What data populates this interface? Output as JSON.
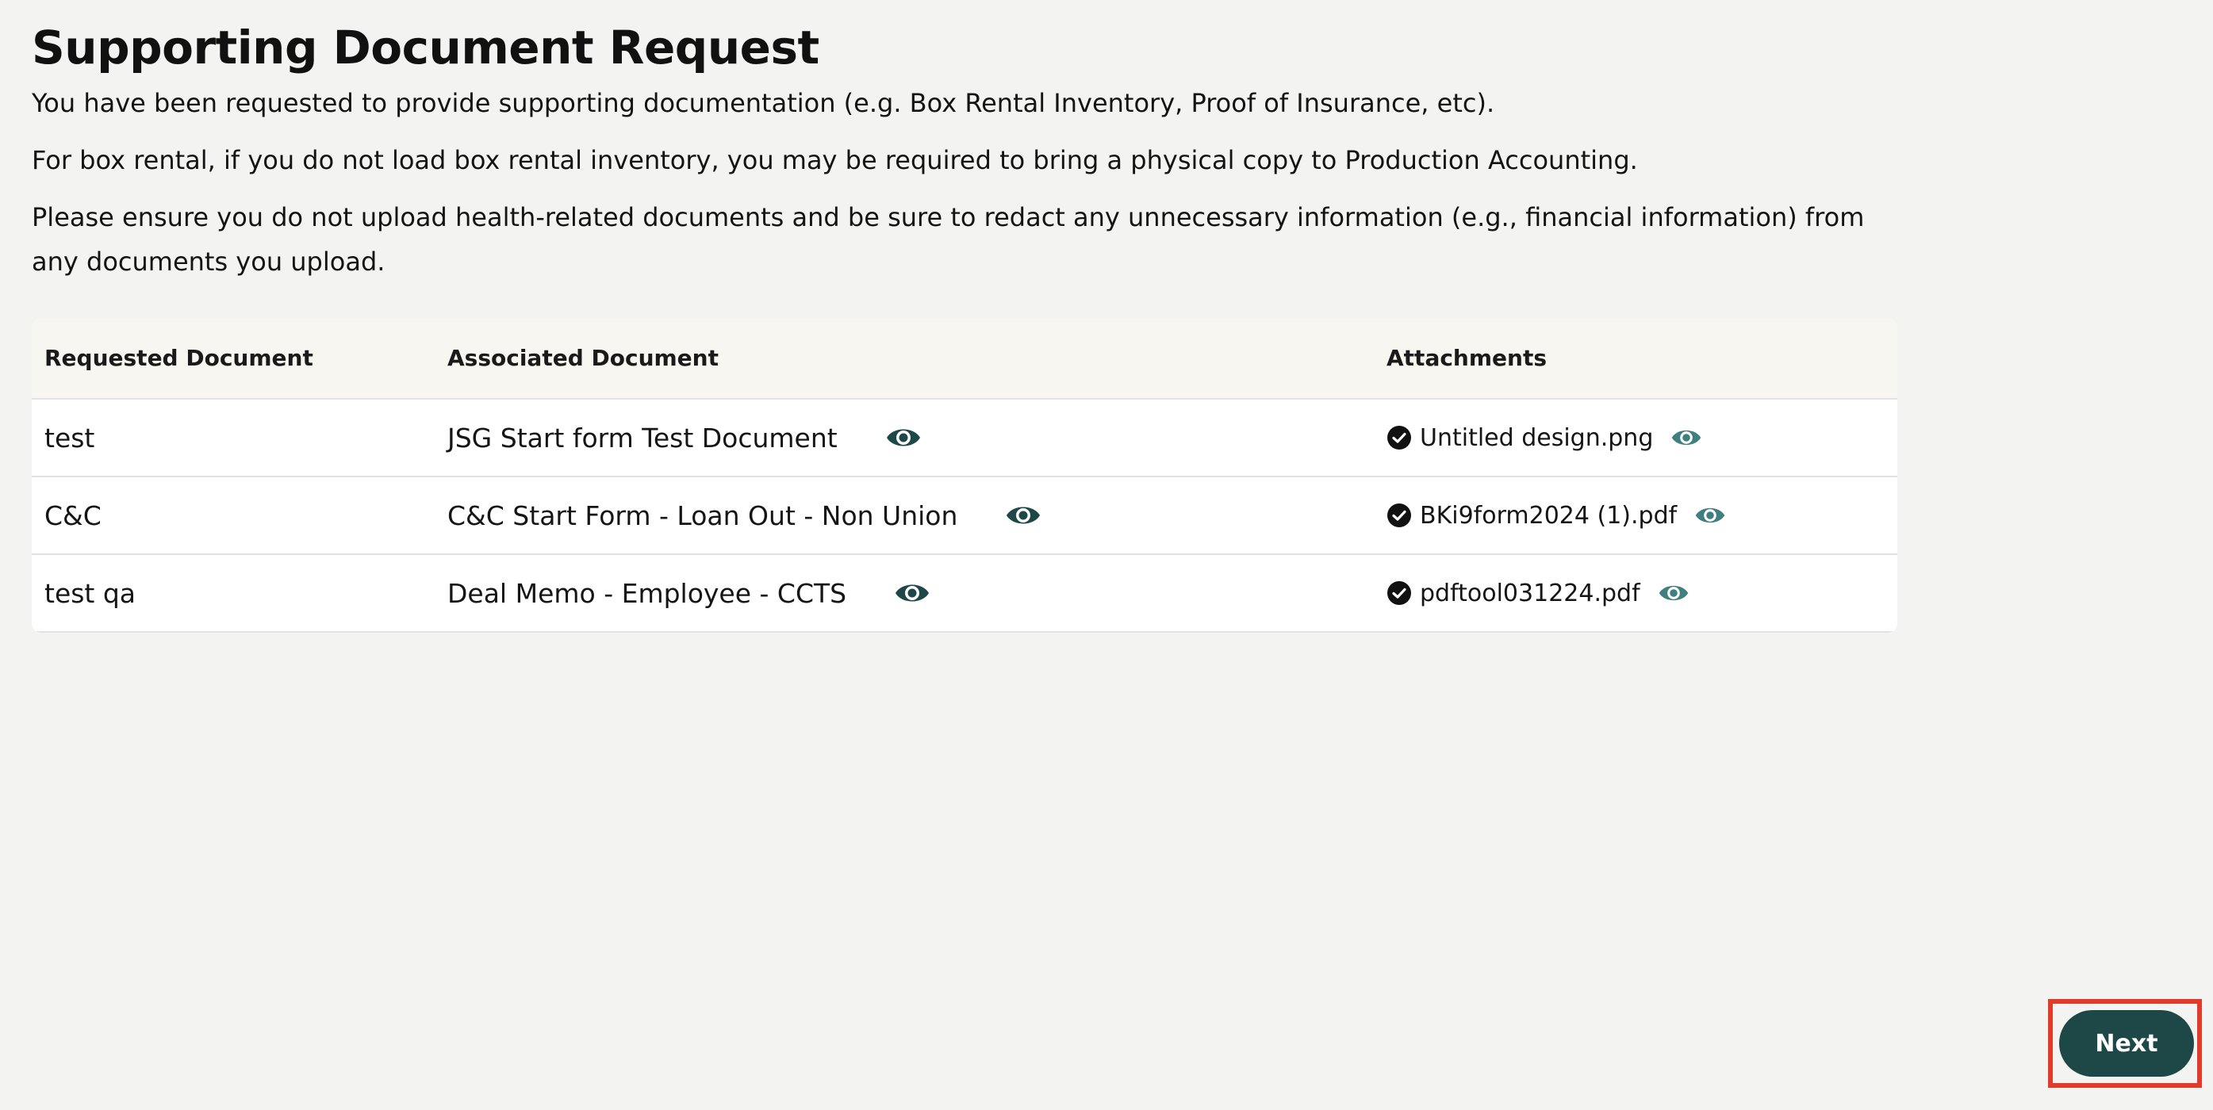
{
  "page": {
    "title": "Supporting Document Request",
    "paragraphs": [
      "You have been requested to provide supporting documentation (e.g. Box Rental Inventory, Proof of Insurance, etc).",
      "For box rental, if you do not load box rental inventory, you may be required to bring a physical copy to Production Accounting.",
      "Please ensure you do not upload health-related documents and be sure to redact any unnecessary information (e.g., financial information) from any documents you upload."
    ]
  },
  "table": {
    "headers": {
      "requested": "Requested Document",
      "associated": "Associated Document",
      "attachments": "Attachments"
    },
    "rows": [
      {
        "requested": "test",
        "associated": "JSG Start form Test Document",
        "attachment": "Untitled design.png"
      },
      {
        "requested": "C&C",
        "associated": "C&C Start Form - Loan Out - Non Union",
        "attachment": "BKi9form2024 (1).pdf"
      },
      {
        "requested": "test qa",
        "associated": "Deal Memo - Employee - CCTS",
        "attachment": "pdftool031224.pdf"
      }
    ]
  },
  "footer": {
    "next_label": "Next"
  },
  "colors": {
    "background": "#f3f3f1",
    "primary": "#1e4747",
    "eye_dark": "#1e4747",
    "eye_light": "#3f7f80",
    "highlight": "#e23b2b"
  },
  "icons": {
    "view": "eye-icon",
    "attached": "check-circle-icon"
  }
}
